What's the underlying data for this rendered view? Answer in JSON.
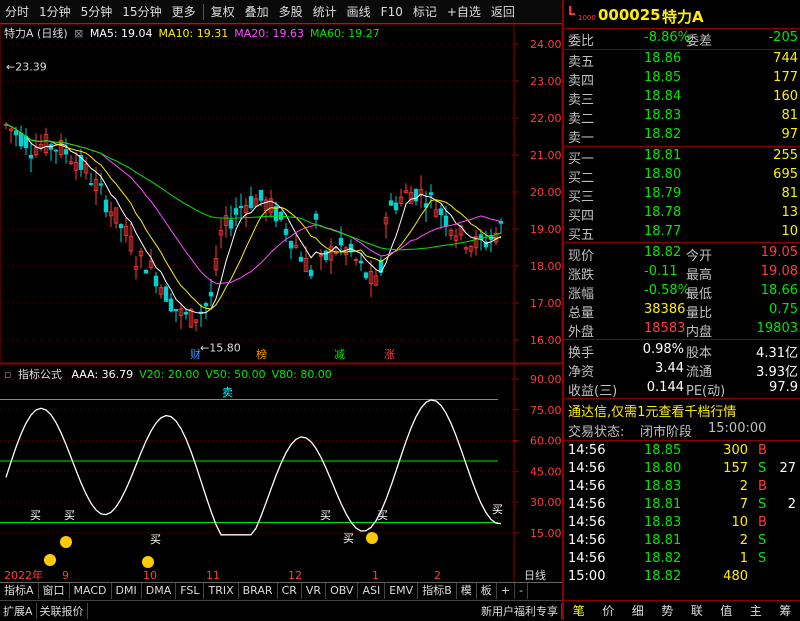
{
  "toolbar": {
    "items": [
      "分时",
      "1分钟",
      "5分钟",
      "15分钟",
      "更多",
      "复权",
      "叠加",
      "多股",
      "统计",
      "画线",
      "F10",
      "标记",
      "+自选",
      "返回"
    ]
  },
  "main_chart": {
    "title": "特力A (日线)",
    "ma": [
      {
        "label": "MA5: 19.04",
        "color": "#ffffff"
      },
      {
        "label": "MA10: 19.31",
        "color": "#ffee00"
      },
      {
        "label": "MA20: 19.63",
        "color": "#ff4cff"
      },
      {
        "label": "MA60: 19.27",
        "color": "#00e600"
      }
    ],
    "y_labels": [
      "24.00",
      "23.00",
      "22.00",
      "21.00",
      "20.00",
      "19.00",
      "18.00",
      "17.00",
      "16.00"
    ],
    "high_mark": "23.39",
    "low_mark": "15.80",
    "tags": [
      {
        "text": "财",
        "color": "#3399ff"
      },
      {
        "text": "榜",
        "color": "#ff9900"
      },
      {
        "text": "减",
        "color": "#00e600"
      },
      {
        "text": "涨",
        "color": "#ff3b3b"
      }
    ]
  },
  "indicator": {
    "title": "指标公式",
    "values": [
      {
        "label": "AAA: 36.79",
        "color": "#ffffff"
      },
      {
        "label": "V20: 20.00",
        "color": "#00e600"
      },
      {
        "label": "V50: 50.00",
        "color": "#00e600"
      },
      {
        "label": "V80: 80.00",
        "color": "#00e600"
      }
    ],
    "y_labels": [
      "90.00",
      "75.00",
      "60.00",
      "45.00",
      "30.00",
      "15.00"
    ],
    "buy_label": "买",
    "sell_label": "卖"
  },
  "x_axis": {
    "labels": [
      "2022年",
      "9",
      "10",
      "11",
      "12",
      "1",
      "2"
    ],
    "period": "日线"
  },
  "bottom_tabs": [
    "指标A",
    "窗口",
    "MACD",
    "DMI",
    "DMA",
    "FSL",
    "TRIX",
    "BRAR",
    "CR",
    "VR",
    "OBV",
    "ASI",
    "EMV",
    "指标B",
    "模",
    "板",
    "+",
    "-"
  ],
  "bottom_bar": [
    "扩展A",
    "关联报价",
    "新用户福利专享"
  ],
  "quote": {
    "code": "000025",
    "name": "特力A",
    "badge": "L",
    "badge_sub": "1000",
    "wb_label": "委比",
    "wb_value": "-8.86%",
    "wc_label": "委差",
    "wc_value": "-205",
    "sells": [
      {
        "label": "卖五",
        "price": "18.86",
        "vol": "744"
      },
      {
        "label": "卖四",
        "price": "18.85",
        "vol": "177"
      },
      {
        "label": "卖三",
        "price": "18.84",
        "vol": "160"
      },
      {
        "label": "卖二",
        "price": "18.83",
        "vol": "81"
      },
      {
        "label": "卖一",
        "price": "18.82",
        "vol": "97"
      }
    ],
    "buys": [
      {
        "label": "买一",
        "price": "18.81",
        "vol": "255"
      },
      {
        "label": "买二",
        "price": "18.80",
        "vol": "695"
      },
      {
        "label": "买三",
        "price": "18.79",
        "vol": "81"
      },
      {
        "label": "买四",
        "price": "18.78",
        "vol": "13"
      },
      {
        "label": "买五",
        "price": "18.77",
        "vol": "10"
      }
    ],
    "stats": [
      {
        "l1": "现价",
        "v1": "18.82",
        "c1": "green",
        "l2": "今开",
        "v2": "19.05",
        "c2": "red"
      },
      {
        "l1": "涨跌",
        "v1": "-0.11",
        "c1": "green",
        "l2": "最高",
        "v2": "19.08",
        "c2": "red"
      },
      {
        "l1": "涨幅",
        "v1": "-0.58%",
        "c1": "green",
        "l2": "最低",
        "v2": "18.66",
        "c2": "green"
      },
      {
        "l1": "总量",
        "v1": "38386",
        "c1": "yellow",
        "l2": "量比",
        "v2": "0.75",
        "c2": "green"
      },
      {
        "l1": "外盘",
        "v1": "18583",
        "c1": "red",
        "l2": "内盘",
        "v2": "19803",
        "c2": "green"
      }
    ],
    "stats2": [
      {
        "l1": "换手",
        "v1": "0.98%",
        "l2": "股本",
        "v2": "4.31亿"
      },
      {
        "l1": "净资",
        "v1": "3.44",
        "l2": "流通",
        "v2": "3.93亿"
      },
      {
        "l1": "收益(三)",
        "v1": "0.144",
        "l2": "PE(动)",
        "v2": "97.9"
      }
    ],
    "promo": "通达信,仅需1元查看千档行情",
    "status_label": "交易状态:",
    "status_value": "闭市阶段",
    "status_time": "15:00:00",
    "ticks": [
      {
        "t": "14:56",
        "p": "18.85",
        "v": "300",
        "s": "B"
      },
      {
        "t": "14:56",
        "p": "18.80",
        "v": "157",
        "s": "S"
      },
      {
        "t": "14:56",
        "p": "18.83",
        "v": "2",
        "s": "B"
      },
      {
        "t": "14:56",
        "p": "18.81",
        "v": "7",
        "s": "S"
      },
      {
        "t": "14:56",
        "p": "18.83",
        "v": "10",
        "s": "B"
      },
      {
        "t": "14:56",
        "p": "18.81",
        "v": "2",
        "s": "S"
      },
      {
        "t": "14:56",
        "p": "18.82",
        "v": "1",
        "s": "S"
      },
      {
        "t": "15:00",
        "p": "18.82",
        "v": "480",
        "s": ""
      }
    ],
    "tick_extra": [
      "27",
      "2"
    ],
    "tabs": [
      "笔",
      "价",
      "细",
      "势",
      "联",
      "值",
      "主",
      "筹"
    ]
  }
}
